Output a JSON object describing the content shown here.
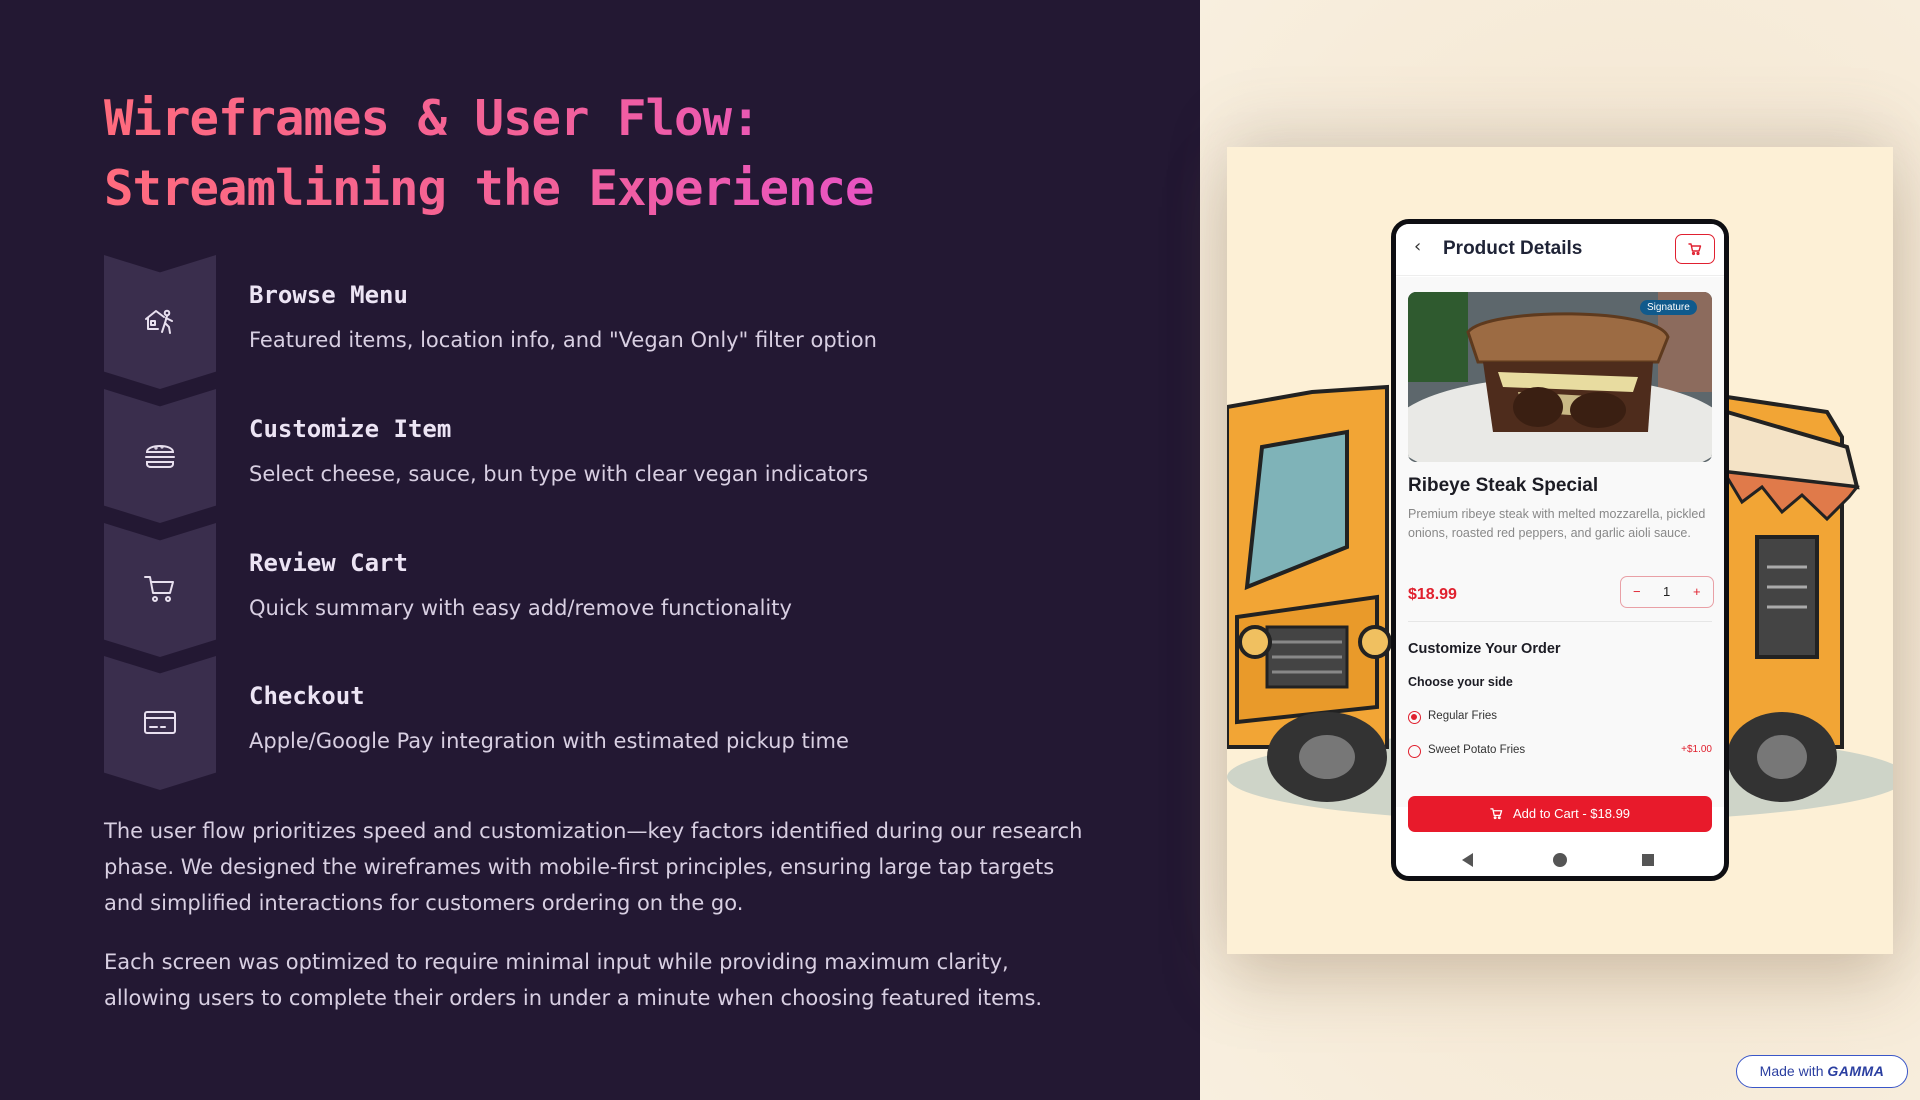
{
  "slide": {
    "title_line1": "Wireframes & User Flow:",
    "title_line2": "Streamlining the Experience",
    "steps": [
      {
        "title": "Browse Menu",
        "desc": "Featured items, location info, and \"Vegan Only\" filter option",
        "icon": "browse-menu-icon"
      },
      {
        "title": "Customize Item",
        "desc": "Select cheese, sauce, bun type with clear vegan indicators",
        "icon": "burger-icon"
      },
      {
        "title": "Review Cart",
        "desc": "Quick summary with easy add/remove functionality",
        "icon": "cart-icon"
      },
      {
        "title": "Checkout",
        "desc": "Apple/Google Pay integration with estimated pickup time",
        "icon": "credit-card-icon"
      }
    ],
    "paragraph1": "The user flow prioritizes speed and customization—key factors identified during our research phase. We designed the wireframes with mobile-first principles, ensuring large tap targets and simplified interactions for customers ordering on the go.",
    "paragraph2": "Each screen was optimized to require minimal input while providing maximum clarity, allowing users to complete their orders in under a minute when choosing featured items."
  },
  "phone": {
    "header_title": "Product Details",
    "badge": "Signature",
    "product_name": "Ribeye Steak Special",
    "product_desc": "Premium ribeye steak with melted mozzarella, pickled onions, roasted red peppers, and garlic aioli sauce.",
    "price": "$18.99",
    "quantity": "1",
    "qty_minus": "−",
    "qty_plus": "+",
    "customize_heading": "Customize Your Order",
    "side_heading": "Choose your side",
    "options": [
      {
        "label": "Regular Fries",
        "price": "",
        "selected": true
      },
      {
        "label": "Sweet Potato Fries",
        "price": "+$1.00",
        "selected": false
      }
    ],
    "add_button": "Add to Cart - $18.99"
  },
  "badge": {
    "prefix": "Made with",
    "brand": "GAMMA"
  },
  "colors": {
    "accent": "#e81a2b",
    "title_start": "#ff6b7d",
    "title_end": "#e14be0",
    "background": "#231833"
  }
}
